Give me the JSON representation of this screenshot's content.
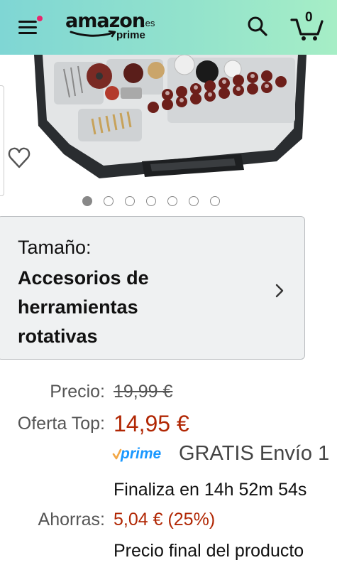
{
  "header": {
    "logo_word": "amazon",
    "logo_tld": ".es",
    "logo_sub": "prime",
    "cart_count": "0",
    "colors": {
      "gradient_start": "#7fd6d4",
      "gradient_end": "#a6eec6",
      "notification_dot": "#e8266d"
    }
  },
  "icons": {
    "menu": "hamburger-menu-icon",
    "search": "search-icon",
    "cart": "cart-icon",
    "wishlist": "heart-icon",
    "chevron": "chevron-right-icon"
  },
  "carousel": {
    "total": 7,
    "active_index": 0
  },
  "size_selector": {
    "label": "Tamaño:",
    "value_lines": [
      "Accesorios de",
      "herramientas",
      "rotativas"
    ]
  },
  "pricing": {
    "price_label": "Precio:",
    "price_value": "19,99 €",
    "offer_label": "Oferta Top:",
    "offer_value": "14,95 €",
    "prime_text": "prime",
    "shipping": "GRATIS Envío 1",
    "deal_timer": "Finaliza en 14h 52m 54s",
    "savings_label": "Ahorras:",
    "savings_value": "5,04 € (25%)",
    "final_price_note": "Precio final del producto",
    "colors": {
      "offer": "#b12704",
      "prime": "#1a98ff"
    }
  }
}
